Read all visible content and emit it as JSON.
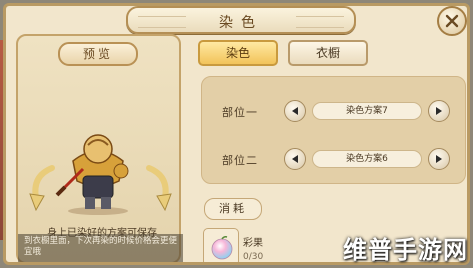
{
  "title": "染色",
  "close_button": {
    "icon": "close-icon"
  },
  "preview": {
    "tag": "预览",
    "hint": "身上已染好的方案可保存",
    "description": "到衣橱里面，下次再染的时候价格会更便宜哦"
  },
  "tabs": [
    {
      "label": "染色",
      "active": true
    },
    {
      "label": "衣橱",
      "active": false
    }
  ],
  "parts": [
    {
      "label": "部位一",
      "scheme": "染色方案7"
    },
    {
      "label": "部位二",
      "scheme": "染色方案6"
    }
  ],
  "cost": {
    "tag": "消耗",
    "material_name": "彩果",
    "material_count": "0/30",
    "material_icon": "colorful-fruit-icon"
  },
  "watermark": "维普手游网",
  "colors": {
    "frame_bg": "#f2e6cc",
    "frame_border": "#b99a63",
    "active_tab": "#f2c35a",
    "panel_bg": "#e3cfa7",
    "text_brown": "#4b3a24"
  }
}
